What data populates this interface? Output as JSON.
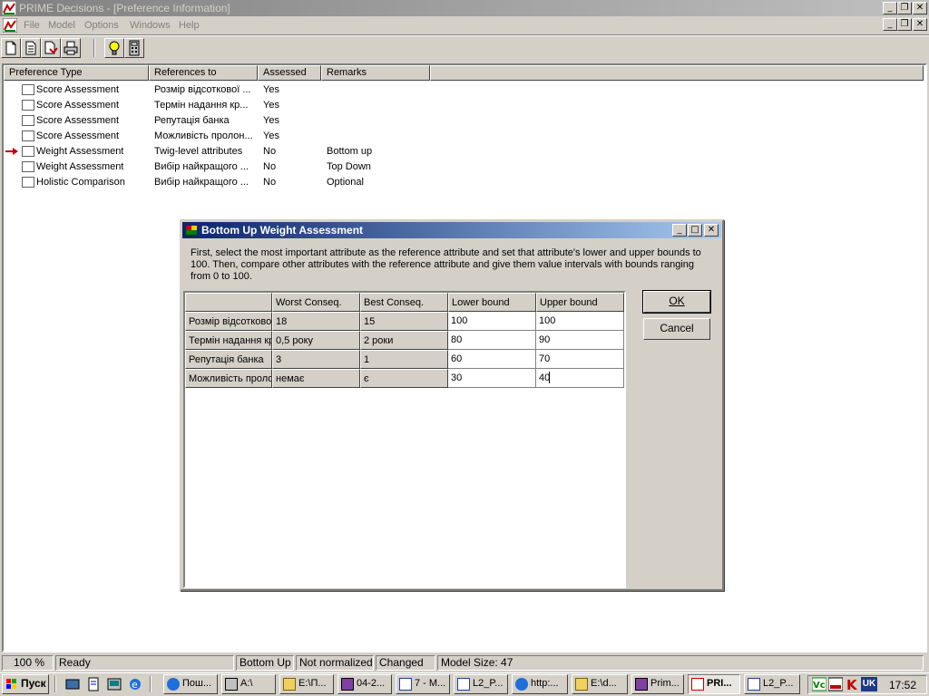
{
  "app": {
    "title": "PRIME Decisions - [Preference Information]",
    "window_buttons": [
      "_",
      "❐",
      "✕"
    ]
  },
  "menu": {
    "items": [
      "File",
      "Model",
      "Options",
      "Windows",
      "Help"
    ]
  },
  "toolbar": {
    "buttons": [
      "new-file",
      "open-file",
      "save-file",
      "print",
      "idea-bulb",
      "calculator"
    ]
  },
  "prefs": {
    "headers": [
      "Preference Type",
      "References to",
      "Assessed",
      "Remarks"
    ],
    "rows": [
      {
        "type": "Score Assessment",
        "ref": "Розмір відсоткової ...",
        "assessed": "Yes",
        "remarks": ""
      },
      {
        "type": "Score Assessment",
        "ref": "Термін надання кр...",
        "assessed": "Yes",
        "remarks": ""
      },
      {
        "type": "Score Assessment",
        "ref": "Репутація банка",
        "assessed": "Yes",
        "remarks": ""
      },
      {
        "type": "Score Assessment",
        "ref": "Можливість пролон...",
        "assessed": "Yes",
        "remarks": ""
      },
      {
        "type": "Weight Assessment",
        "ref": "Twig-level attributes",
        "assessed": "No",
        "remarks": "Bottom up"
      },
      {
        "type": "Weight Assessment",
        "ref": "Вибір найкращого ...",
        "assessed": "No",
        "remarks": "Top Down"
      },
      {
        "type": "Holistic Comparison",
        "ref": "Вибір найкращого ...",
        "assessed": "No",
        "remarks": "Optional"
      }
    ]
  },
  "dialog": {
    "title": "Bottom Up Weight Assessment",
    "instructions": "First, select the most important attribute as the reference attribute and set that attribute's lower and upper bounds to 100. Then, compare other attributes with the reference attribute and give them value intervals with bounds ranging from 0 to 100.",
    "headers": [
      "",
      "Worst Conseq.",
      "Best Conseq.",
      "Lower bound",
      "Upper bound"
    ],
    "rows": [
      {
        "attr": "Розмір відсоткової ставки",
        "worst": "18",
        "best": "15",
        "lower": "100",
        "upper": "100"
      },
      {
        "attr": "Термін надання кредиту",
        "worst": "0,5 року",
        "best": "2 роки",
        "lower": "80",
        "upper": "90"
      },
      {
        "attr": "Репутація банка",
        "worst": "3",
        "best": "1",
        "lower": "60",
        "upper": "70"
      },
      {
        "attr": "Можливість пролонгації",
        "worst": "немає",
        "best": "є",
        "lower": "30",
        "upper": "40"
      }
    ],
    "ok_label": "OK",
    "cancel_label": "Cancel"
  },
  "status": {
    "zoom": "100 %",
    "state": "Ready",
    "mode": "Bottom Up",
    "normalization": "Not normalized",
    "changed": "Changed",
    "model_size": "Model Size: 47"
  },
  "taskbar": {
    "start_label": "Пуск",
    "buttons": [
      "Пош...",
      "A:\\",
      "E:\\П...",
      "04-2...",
      "7 - M...",
      "L2_P...",
      "http:...",
      "E:\\d...",
      "Prim...",
      "PRI...",
      "L2_P..."
    ],
    "tray": {
      "lang": "UK",
      "time": "17:52"
    }
  },
  "colors": {
    "title_active": "#0a246a",
    "title_active_end": "#a6caf0",
    "title_inactive": "#808080",
    "title_inactive_end": "#c0c0c0",
    "face": "#d4d0c8",
    "arrow": "#c00000"
  }
}
